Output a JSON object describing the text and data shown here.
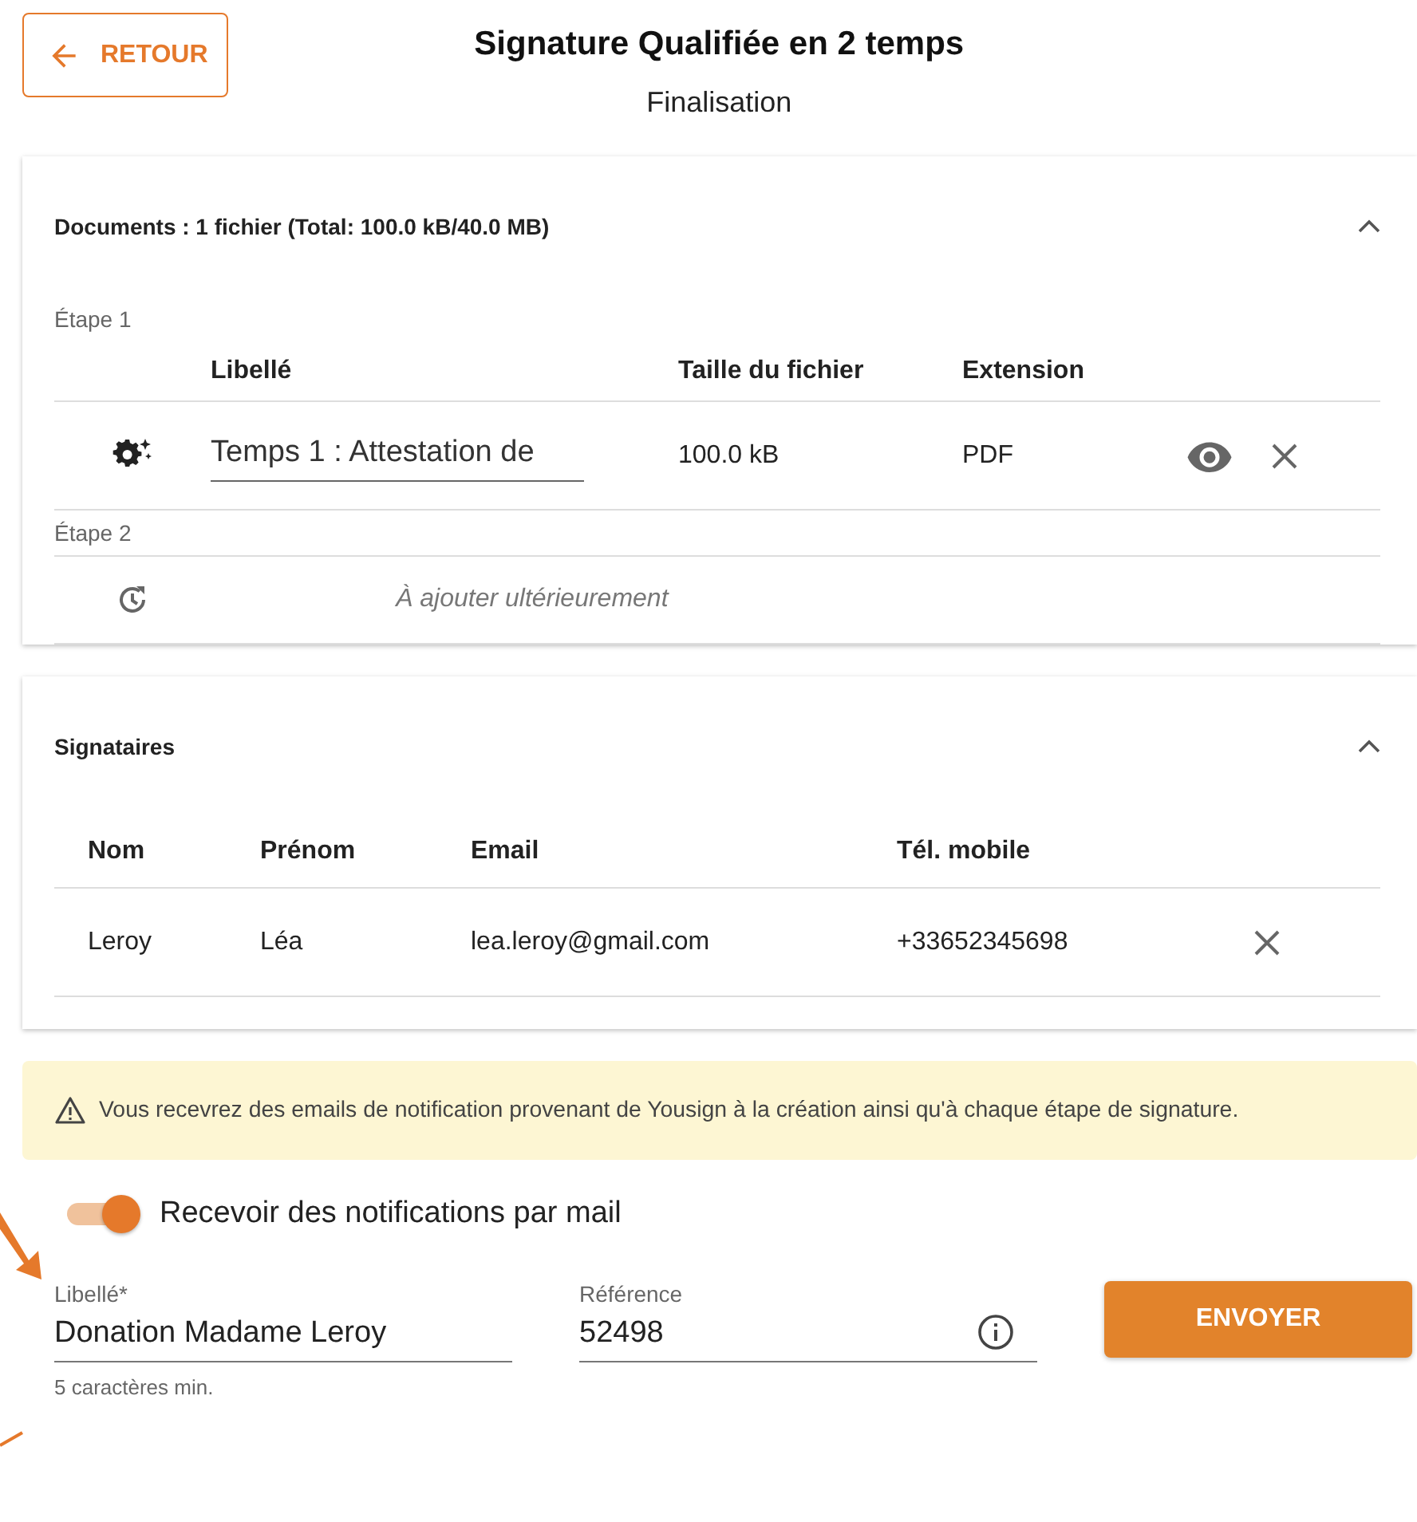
{
  "header": {
    "back_button": "RETOUR",
    "title": "Signature Qualifiée en 2 temps",
    "subtitle": "Finalisation"
  },
  "documents": {
    "title": "Documents : 1 fichier (Total: 100.0 kB/40.0 MB)",
    "expanded": true,
    "steps": [
      {
        "label": "Étape 1",
        "columns": [
          "Libellé",
          "Taille du fichier",
          "Extension"
        ],
        "rows": [
          {
            "kind": "file",
            "label": "Temps 1 : Attestation de",
            "size": "100.0 kB",
            "extension": "PDF"
          }
        ]
      },
      {
        "label": "Étape 2",
        "rows": [
          {
            "kind": "pending",
            "label": "À ajouter ultérieurement"
          }
        ]
      }
    ]
  },
  "signers": {
    "title": "Signataires",
    "expanded": true,
    "columns": [
      "Nom",
      "Prénom",
      "Email",
      "Tél. mobile"
    ],
    "rows": [
      [
        "Leroy",
        "Léa",
        "lea.leroy@gmail.com",
        "+33652345698"
      ]
    ]
  },
  "notice": "Vous recevrez des emails de notification provenant de Yousign à la création ainsi qu'à chaque étape de signature.",
  "notifications": {
    "label": "Recevoir des notifications par mail",
    "on": true
  },
  "form": {
    "label_field": {
      "label": "Libellé*",
      "value": "Donation Madame Leroy",
      "hint": "5 caractères min."
    },
    "reference_field": {
      "label": "Référence",
      "value": "52498"
    },
    "submit": "ENVOYER"
  }
}
